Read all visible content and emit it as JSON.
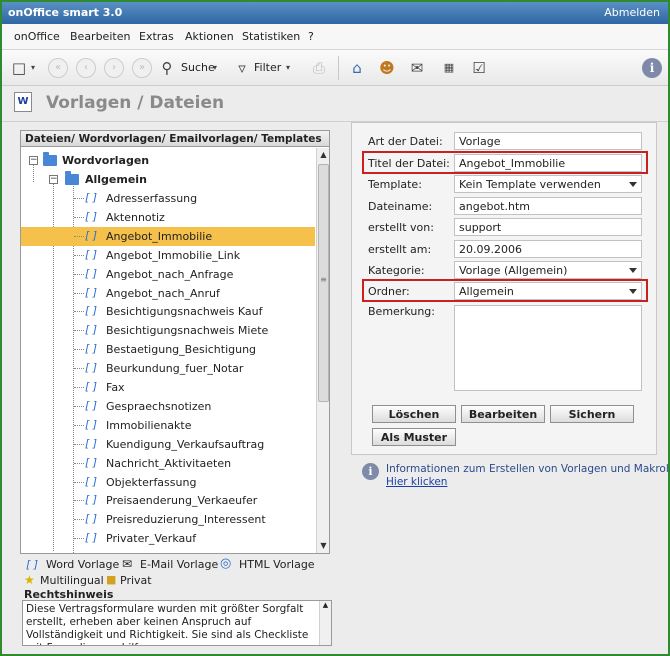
{
  "app": {
    "title": "onOffice smart 3.0",
    "logout": "Abmelden"
  },
  "menu": [
    "onOffice",
    "Bearbeiten",
    "Extras",
    "Aktionen",
    "Statistiken",
    "?"
  ],
  "toolbar": {
    "search_label": "Suche",
    "filter_label": "Filter"
  },
  "page": {
    "title": "Vorlagen / Dateien",
    "doc_icon_letter": "W"
  },
  "tree": {
    "header": "Dateien/ Wordvorlagen/ Emailvorlagen/ Templates",
    "root": "Wordvorlagen",
    "folder": "Allgemein",
    "items": [
      "Adresserfassung",
      "Aktennotiz",
      "Angebot_Immobilie",
      "Angebot_Immobilie_Link",
      "Angebot_nach_Anfrage",
      "Angebot_nach_Anruf",
      "Besichtigungsnachweis Kauf",
      "Besichtigungsnachweis Miete",
      "Bestaetigung_Besichtigung",
      "Beurkundung_fuer_Notar",
      "Fax",
      "Gespraechsnotizen",
      "Immobilienakte",
      "Kuendigung_Verkaufsauftrag",
      "Nachricht_Aktivitaeten",
      "Objekterfassung",
      "Preisaenderung_Verkaeufer",
      "Preisreduzierung_Interessent",
      "Privater_Verkauf"
    ],
    "selected": "Angebot_Immobilie"
  },
  "legend": {
    "word": "Word Vorlage",
    "email": "E-Mail Vorlage",
    "html": "HTML Vorlage",
    "multi": "Multilingual",
    "privat": "Privat"
  },
  "rechtshinweis": {
    "title": "Rechtshinweis",
    "text": "Diese Vertragsformulare wurden mit größter Sorgfalt erstellt, erheben aber keinen Anspruch auf Vollständigkeit und Richtigkeit. Sie sind als Checkliste mit Formulierungshilfen zu"
  },
  "form": {
    "art_label": "Art der Datei:",
    "art_value": "Vorlage",
    "titel_label": "Titel der Datei:",
    "titel_value": "Angebot_Immobilie",
    "template_label": "Template:",
    "template_value": "Kein Template verwenden",
    "dateiname_label": "Dateiname:",
    "dateiname_value": "angebot.htm",
    "erstellt_von_label": "erstellt von:",
    "erstellt_von_value": "support",
    "erstellt_am_label": "erstellt am:",
    "erstellt_am_value": "20.09.2006",
    "kategorie_label": "Kategorie:",
    "kategorie_value": "Vorlage (Allgemein)",
    "ordner_label": "Ordner:",
    "ordner_value": "Allgemein",
    "bemerkung_label": "Bemerkung:",
    "btn_loeschen": "Löschen",
    "btn_bearbeiten": "Bearbeiten",
    "btn_sichern": "Sichern",
    "btn_muster": "Als Muster"
  },
  "info": {
    "message": "Informationen zum Erstellen von Vorlagen und Makroliste.",
    "link": "Hier klicken"
  },
  "colors": {
    "highlight": "#c9211e",
    "selection": "#f5c14b",
    "titlebar": "#2f66a3"
  }
}
